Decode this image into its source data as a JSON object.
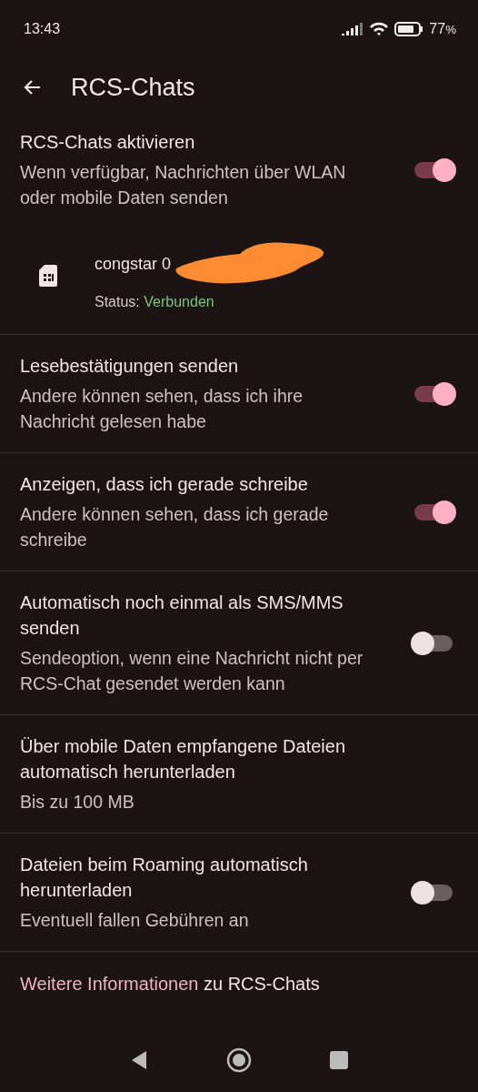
{
  "status_bar": {
    "time": "13:43",
    "battery": "77",
    "battery_unit": "%"
  },
  "app_bar": {
    "title": "RCS-Chats"
  },
  "settings": [
    {
      "kind": "toggle",
      "title": "RCS-Chats aktivieren",
      "subtitle": "Wenn verfügbar, Nachrichten über WLAN oder mobile Daten senden",
      "on": true,
      "sim": {
        "name": "congstar 0",
        "status_label": "Status:",
        "status_value": "Verbunden"
      }
    },
    {
      "kind": "toggle",
      "title": "Lesebestätigungen senden",
      "subtitle": "Andere können sehen, dass ich ihre Nachricht gelesen habe",
      "on": true
    },
    {
      "kind": "toggle",
      "title": "Anzeigen, dass ich gerade schreibe",
      "subtitle": "Andere können sehen, dass ich gerade schreibe",
      "on": true
    },
    {
      "kind": "toggle",
      "title": "Automatisch noch einmal als SMS/MMS senden",
      "subtitle": "Sendeoption, wenn eine Nachricht nicht per RCS-Chat gesendet werden kann",
      "on": false
    },
    {
      "kind": "plain",
      "title": "Über mobile Daten empfangene Dateien automatisch herunterladen",
      "subtitle": "Bis zu 100 MB"
    },
    {
      "kind": "toggle",
      "title": "Dateien beim Roaming automatisch herunterladen",
      "subtitle": "Eventuell fallen Gebühren an",
      "on": false
    }
  ],
  "footer": {
    "link": "Weitere Informationen",
    "rest": " zu RCS-Chats"
  }
}
